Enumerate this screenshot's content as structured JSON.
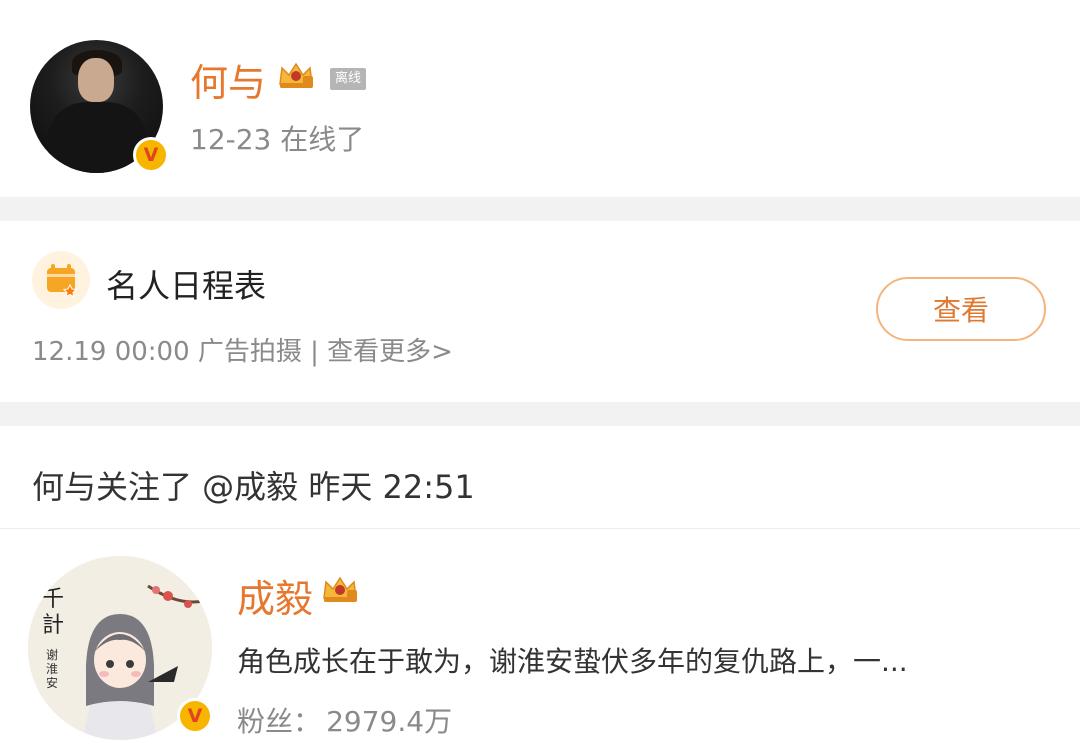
{
  "profile": {
    "name": "何与",
    "status_tag": "离线",
    "last_online": "12-23 在线了",
    "verified_badge": "V"
  },
  "schedule": {
    "title": "名人日程表",
    "meta": "12.19 00:00 广告拍摄 |  查看更多>",
    "button_label": "查看"
  },
  "activity": {
    "follow_text": "何与关注了 @成毅 昨天 22:51"
  },
  "followed_user": {
    "name": "成毅",
    "bio": "角色成长在于敢为，谢淮安蛰伏多年的复仇路上，一...",
    "fans_label": "粉丝：",
    "fans_value": "2979.4万",
    "verified_badge": "V",
    "avatar_caption": "谢淮安"
  },
  "colors": {
    "accent_orange": "#e6772d",
    "badge_gold": "#f7b500",
    "gray_text": "#8a8a8a"
  }
}
